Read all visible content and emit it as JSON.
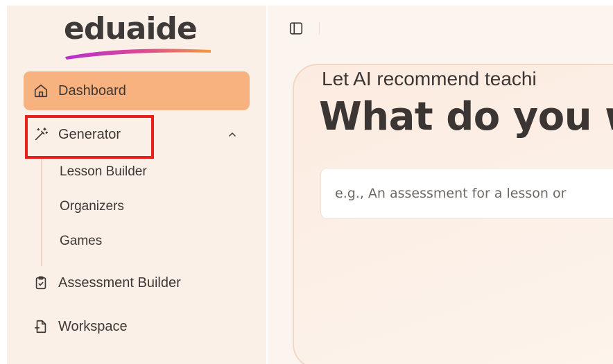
{
  "app": {
    "logo_text": "eduaide"
  },
  "sidebar": {
    "items": [
      {
        "label": "Dashboard",
        "icon": "home-icon",
        "active": true
      },
      {
        "label": "Generator",
        "icon": "magic-wand-icon",
        "expanded": true,
        "expand_icon": "chevron-up-icon"
      },
      {
        "label": "Assessment Builder",
        "icon": "clipboard-check-icon"
      },
      {
        "label": "Workspace",
        "icon": "file-plus-icon"
      }
    ],
    "generator_children": [
      {
        "label": "Lesson Builder"
      },
      {
        "label": "Organizers"
      },
      {
        "label": "Games"
      }
    ]
  },
  "main": {
    "toggle_icon": "sidebar-toggle-icon",
    "card": {
      "eyebrow": "Let AI recommend teachi",
      "title": "What do you w",
      "input_placeholder": "e.g., An assessment for a lesson or"
    }
  },
  "colors": {
    "sidebar_bg": "#fbf0e7",
    "active_bg": "#f8b27f",
    "text": "#3d3835",
    "highlight": "#e8201a",
    "logo_swoosh_start": "#c23bd4",
    "logo_swoosh_end": "#f28b3b"
  }
}
